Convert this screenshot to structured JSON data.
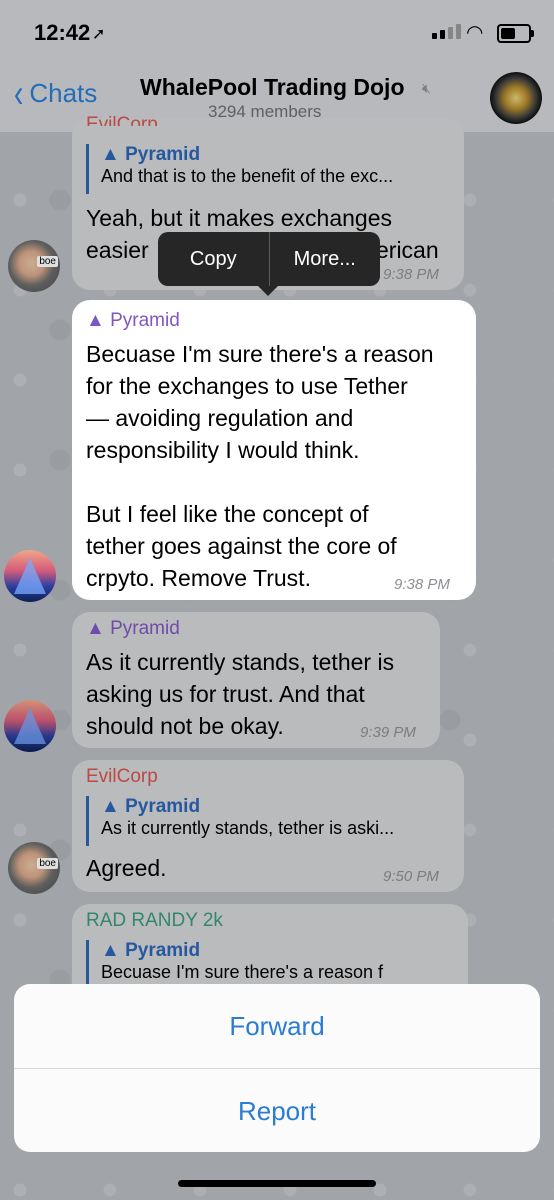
{
  "status_bar": {
    "time": "12:42"
  },
  "nav": {
    "back_label": "Chats",
    "title": "WhalePool Trading Dojo",
    "subtitle": "3294 members"
  },
  "messages": [
    {
      "sender": "EvilCorp",
      "reply_name": "▲ Pyramid",
      "reply_text": "And that is to the benefit of the exc...",
      "line1": "Yeah, but it makes exchanges",
      "line2_left": "easier",
      "line2_right": "erican",
      "time": "9:38 PM"
    },
    {
      "forward_label": "▲ Pyramid",
      "lines": [
        "Becuase I'm sure there's a reason",
        "for the exchanges to use Tether",
        "— avoiding regulation and",
        "responsibility I would think.",
        "",
        "But I feel like the concept of",
        "tether goes against the core of",
        "crpyto. Remove Trust."
      ],
      "time": "9:38 PM"
    },
    {
      "forward_label": "▲ Pyramid",
      "lines": [
        "As it currently stands, tether is",
        "asking us for trust. And that",
        "should not be okay."
      ],
      "time": "9:39 PM"
    },
    {
      "sender": "EvilCorp",
      "reply_name": "▲ Pyramid",
      "reply_text": "As it currently stands, tether is aski...",
      "text": "Agreed.",
      "time": "9:50 PM"
    },
    {
      "sender": "RAD RANDY 2k",
      "reply_name": "▲ Pyramid",
      "reply_text": "Becuase I'm sure there's a reason f"
    }
  ],
  "context_menu": {
    "copy": "Copy",
    "more": "More..."
  },
  "action_sheet": {
    "forward": "Forward",
    "report": "Report"
  },
  "colors": {
    "accent": "#2b7cd3",
    "evilcorp": "#d9534f",
    "randy": "#3a9a7a",
    "forward": "#7e57c2",
    "reply": "#2b65b6"
  },
  "icons": [
    "location-arrow-icon",
    "signal-icon",
    "wifi-icon",
    "battery-icon",
    "chevron-left-icon",
    "mute-icon"
  ]
}
